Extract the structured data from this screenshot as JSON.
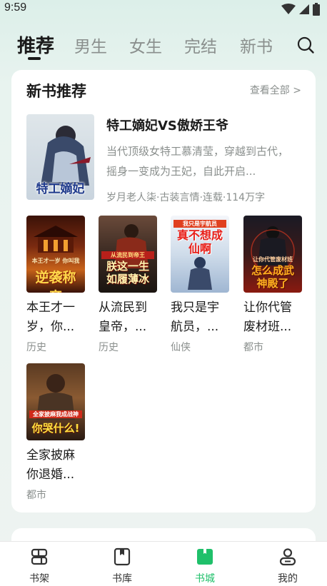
{
  "status_bar": {
    "time": "9:59"
  },
  "tabs": [
    {
      "label": "推荐",
      "active": true
    },
    {
      "label": "男生"
    },
    {
      "label": "女生"
    },
    {
      "label": "完结"
    },
    {
      "label": "新书"
    }
  ],
  "section": {
    "title": "新书推荐",
    "view_all": "查看全部 >"
  },
  "featured": {
    "title": "特工嫡妃VS傲娇王爷",
    "description": "当代顶级女特工慕清莹，穿越到古代，摇身一变成为王妃，自此开启...",
    "meta": "岁月老人柒·古装言情·连载·114万字",
    "cover_text": "特工嫡妃"
  },
  "books": [
    {
      "title": "本王才一岁，你...",
      "genre": "历史",
      "cover_text": "逆袭称帝",
      "cover_small": "本王才一岁 你叫我"
    },
    {
      "title": "从流民到皇帝，...",
      "genre": "历史",
      "cover_text": "朕这一生如履薄冰",
      "cover_small": "从流民到帝王"
    },
    {
      "title": "我只是宇航员，...",
      "genre": "仙侠",
      "cover_text": "真不想成仙啊",
      "cover_small": "我只是宇航员"
    },
    {
      "title": "让你代管废材班...",
      "genre": "都市",
      "cover_text": "怎么成武神殿了",
      "cover_small": "让你代管废材班"
    },
    {
      "title": "全家披麻你退婚...",
      "genre": "都市",
      "cover_text": "你哭什么!",
      "cover_small": "全家披麻我成战神"
    }
  ],
  "bottom_nav": [
    {
      "label": "书架",
      "icon": "bookshelf-icon"
    },
    {
      "label": "书库",
      "icon": "library-icon"
    },
    {
      "label": "书城",
      "icon": "bookstore-icon",
      "active": true
    },
    {
      "label": "我的",
      "icon": "profile-icon"
    }
  ],
  "colors": {
    "accent": "#1fc06a",
    "muted": "#8a8f8d",
    "text": "#1a1a1a"
  }
}
